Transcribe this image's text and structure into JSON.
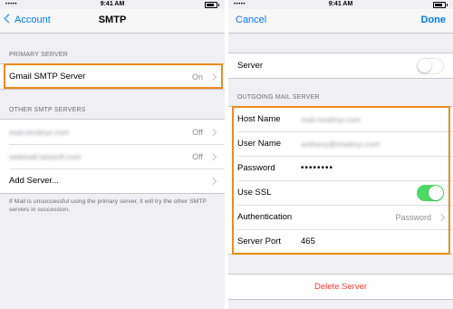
{
  "left": {
    "status": {
      "carrier": "•••••",
      "time": "9:41 AM"
    },
    "nav": {
      "back_label": "Account",
      "title": "SMTP"
    },
    "primary_header": "PRIMARY SERVER",
    "primary_server": {
      "label": "Gmail SMTP Server",
      "value": "On"
    },
    "other_header": "OTHER SMTP SERVERS",
    "other_servers": [
      {
        "label": "mail.modmyi.com",
        "value": "Off"
      },
      {
        "label": "webmail.talosoft.com",
        "value": "Off"
      }
    ],
    "add_server_label": "Add Server...",
    "footer_note": "If Mail is unsuccessful using the primary server, it will try the other SMTP servers in succession."
  },
  "right": {
    "status": {
      "carrier": "•••••",
      "time": "9:41 AM"
    },
    "nav": {
      "cancel_label": "Cancel",
      "done_label": "Done"
    },
    "server_label": "Server",
    "server_enabled": false,
    "outgoing_header": "OUTGOING MAIL SERVER",
    "host_name": {
      "label": "Host Name",
      "value": "mail.modmyi.com"
    },
    "user_name": {
      "label": "User Name",
      "value": "anthony@modmyi.com"
    },
    "password": {
      "label": "Password",
      "value": "••••••••"
    },
    "use_ssl": {
      "label": "Use SSL",
      "enabled": true
    },
    "authentication": {
      "label": "Authentication",
      "value": "Password"
    },
    "server_port": {
      "label": "Server Port",
      "value": "465"
    },
    "delete_label": "Delete Server"
  },
  "colors": {
    "accent": "#007aff",
    "highlight": "#f08a1c",
    "toggle_on": "#4cd964",
    "destructive": "#ff3b30"
  }
}
